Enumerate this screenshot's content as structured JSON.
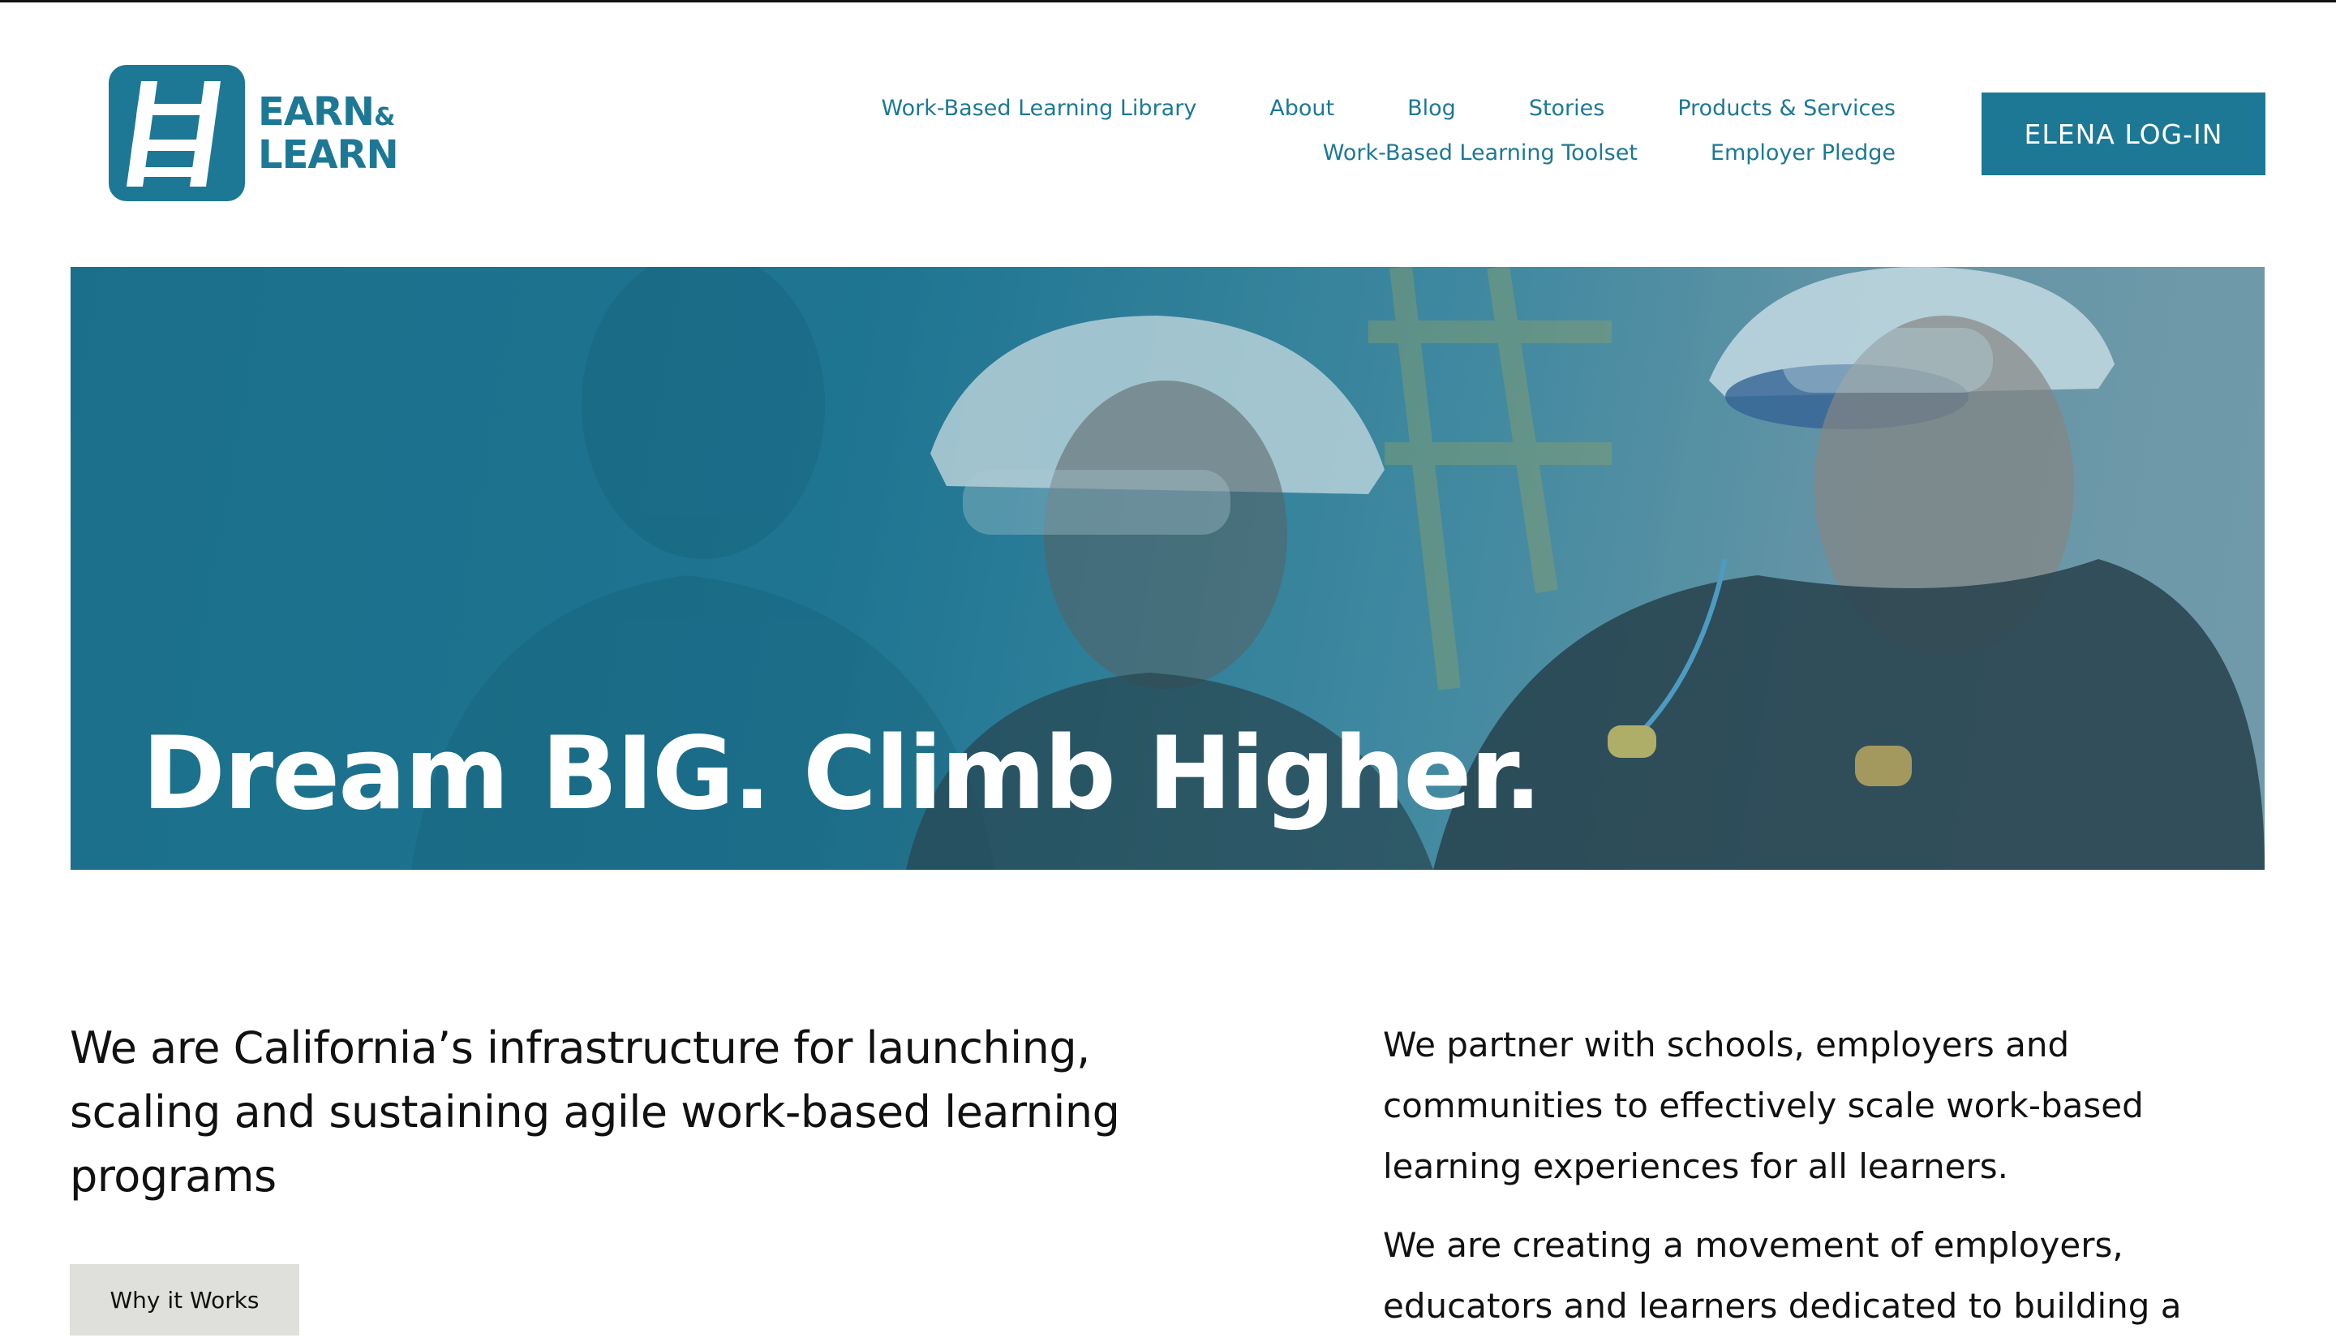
{
  "brand": {
    "logo_line1": "EARN",
    "logo_amp": "&",
    "logo_line2": "LEARN",
    "accent_color": "#1d7895"
  },
  "nav": {
    "row1": [
      "Work-Based Learning Library",
      "About",
      "Blog",
      "Stories",
      "Products & Services"
    ],
    "row2": [
      "Work-Based Learning Toolset",
      "Employer Pledge"
    ],
    "login_label": "ELENA LOG-IN"
  },
  "hero": {
    "title": "Dream BIG. Climb Higher."
  },
  "intro": {
    "lead": "We are California’s infrastructure for launching, scaling and sustaining agile work-based learning programs",
    "button_label": "Why it Works",
    "paragraph1": "We partner with schools, employers and communities to effectively scale work-based learning experiences for all learners.",
    "paragraph2": "We are creating a movement of employers, educators and learners dedicated to building a"
  }
}
